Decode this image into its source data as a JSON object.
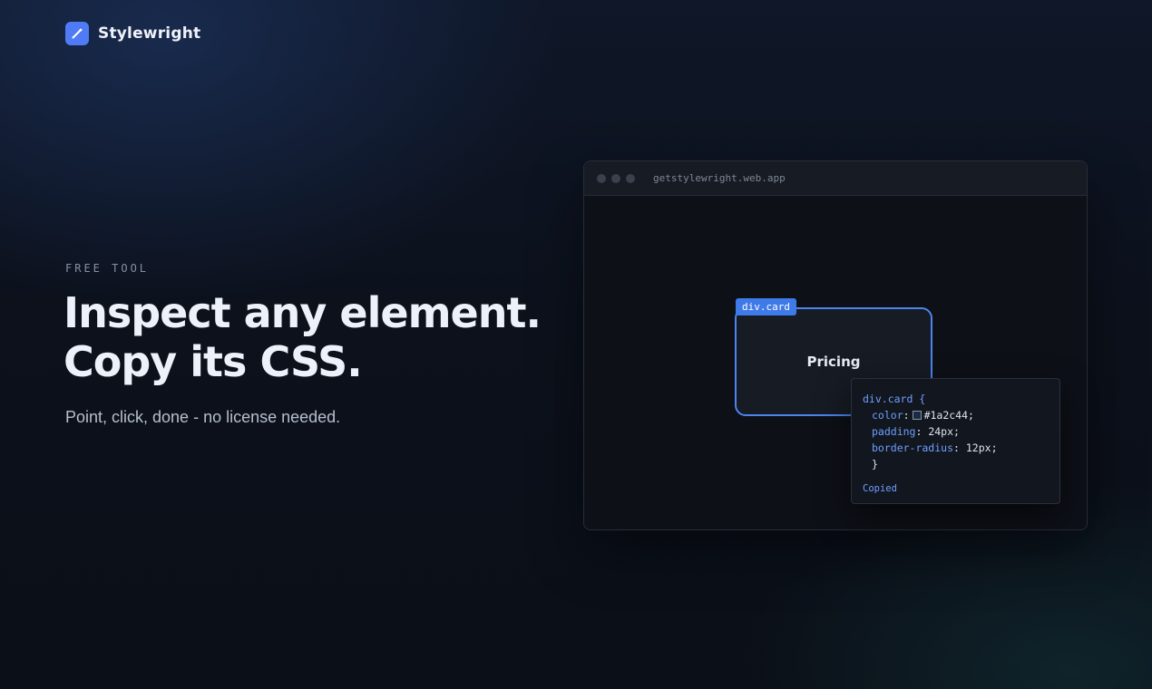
{
  "brand": {
    "name": "Stylewright",
    "logo_icon": "pen-icon",
    "accent": "#4f7cf6"
  },
  "hero": {
    "eyebrow": "FREE TOOL",
    "headline_line1": "Inspect any element.",
    "headline_line2": "Copy its CSS.",
    "subhead": "Point, click, done - no license needed."
  },
  "browser": {
    "url": "getstylewright.web.app",
    "card": {
      "tag": "div.card",
      "title": "Pricing",
      "highlight_color": "#4d84f0"
    },
    "css_popup": {
      "selector": "div.card {",
      "rules": [
        {
          "prop": "color",
          "value": "#1a2c44;",
          "swatch": "#1a2c44"
        },
        {
          "prop": "padding",
          "value": "24px;"
        },
        {
          "prop": "border-radius",
          "value": "12px;"
        }
      ],
      "close": "}",
      "status": "Copied"
    }
  }
}
